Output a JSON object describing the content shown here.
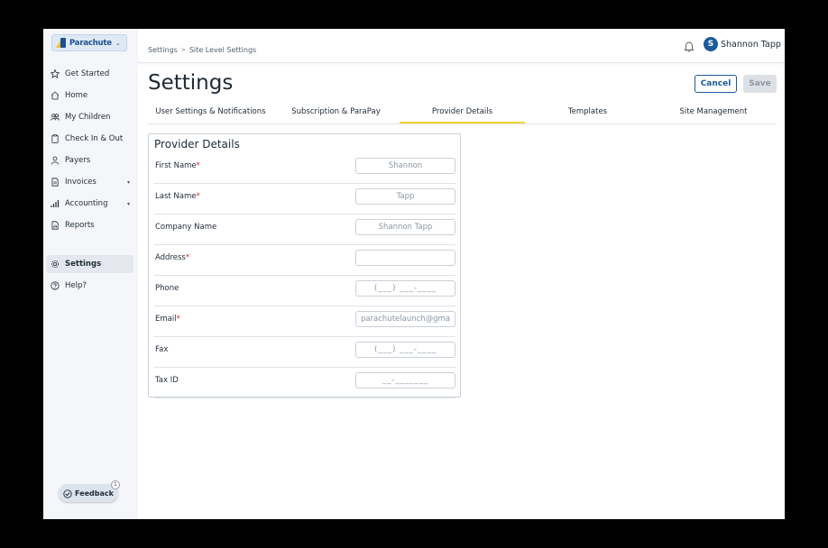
{
  "sidebar": {
    "logo_text": "Parachute",
    "items": [
      {
        "label": "Get Started",
        "icon": "star-icon"
      },
      {
        "label": "Home",
        "icon": "home-icon"
      },
      {
        "label": "My Children",
        "icon": "children-icon"
      },
      {
        "label": "Check In & Out",
        "icon": "clipboard-icon"
      },
      {
        "label": "Payers",
        "icon": "person-icon"
      },
      {
        "label": "Invoices",
        "icon": "document-icon",
        "expandable": true
      },
      {
        "label": "Accounting",
        "icon": "bar-chart-icon",
        "expandable": true
      },
      {
        "label": "Reports",
        "icon": "report-icon"
      },
      {
        "label": "Settings",
        "icon": "gear-icon",
        "active": true
      },
      {
        "label": "Help?",
        "icon": "help-icon"
      }
    ],
    "feedback_label": "Feedback",
    "feedback_badge": "1"
  },
  "topbar": {
    "breadcrumb": [
      "Settings",
      "Site Level Settings"
    ],
    "user_initial": "S",
    "user_name": "Shannon Tapp"
  },
  "main": {
    "title": "Settings",
    "cancel_label": "Cancel",
    "save_label": "Save",
    "tabs": [
      {
        "label": "User Settings & Notifications"
      },
      {
        "label": "Subscription & ParaPay"
      },
      {
        "label": "Provider Details",
        "active": true
      },
      {
        "label": "Templates"
      },
      {
        "label": "Site Management"
      }
    ]
  },
  "form": {
    "title": "Provider Details",
    "fields": [
      {
        "label": "First Name",
        "required": true,
        "value": "Shannon",
        "placeholder": ""
      },
      {
        "label": "Last Name",
        "required": true,
        "value": "Tapp",
        "placeholder": ""
      },
      {
        "label": "Company Name",
        "required": false,
        "value": "Shannon Tapp",
        "placeholder": ""
      },
      {
        "label": "Address",
        "required": true,
        "value": "",
        "placeholder": ""
      },
      {
        "label": "Phone",
        "required": false,
        "value": "",
        "placeholder": "(___) ___-____"
      },
      {
        "label": "Email",
        "required": true,
        "value": "parachutelaunch@gma",
        "placeholder": ""
      },
      {
        "label": "Fax",
        "required": false,
        "value": "",
        "placeholder": "(___) ___-____"
      },
      {
        "label": "Tax ID",
        "required": false,
        "value": "",
        "placeholder": "__-_______"
      }
    ]
  },
  "colors": {
    "brand_blue": "#1c5a9c",
    "active_tab_underline": "#f2d43a",
    "required_star": "#d62a2a",
    "sidebar_bg": "#f4f6f9"
  }
}
